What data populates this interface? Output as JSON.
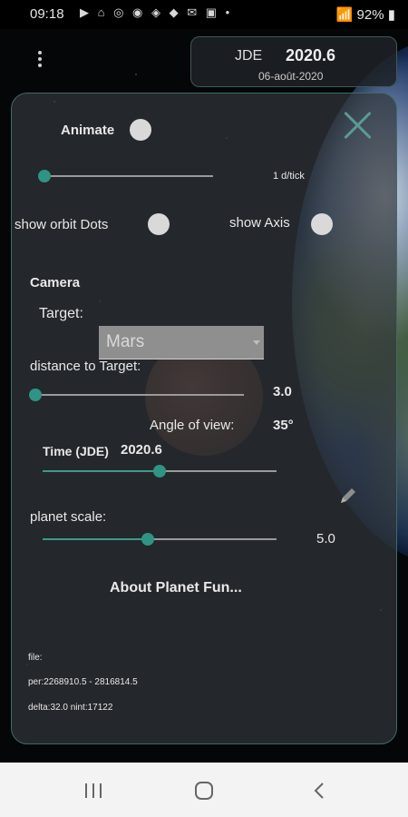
{
  "status_bar": {
    "time": "09:18",
    "battery": "92%",
    "notification_icons": [
      "youtube-icon",
      "bank-icon",
      "sync-icon",
      "chrome-icon",
      "maps-icon",
      "maps-pin-icon",
      "gmail-icon",
      "gallery-icon"
    ]
  },
  "header": {
    "jde_label": "JDE",
    "jde_value": "2020.6",
    "date": "06-août-2020"
  },
  "panel": {
    "animate_label": "Animate",
    "tick_value_label": "1 d/tick",
    "tick_slider_value": 0.0,
    "show_orbit_dots_label": "show orbit Dots",
    "show_axis_label": "show Axis",
    "camera_heading": "Camera",
    "target_label": "Target:",
    "target_value": "Mars",
    "distance_label": "distance to Target:",
    "distance_value": "3.0",
    "distance_slider_value": 0.0,
    "angle_label": "Angle of view:",
    "angle_value": "35°",
    "time_label": "Time (JDE)",
    "time_value": "2020.6",
    "time_slider_value": 0.5,
    "planet_scale_label": "planet scale:",
    "planet_scale_value": "5.0",
    "planet_scale_slider_value": 0.45,
    "about_link": "About Planet Fun...",
    "file_label": "file:",
    "per_text": "per:2268910.5 - 2816814.5",
    "delta_text": "delta:32.0 nint:17122"
  },
  "colors": {
    "accent": "#2f9483",
    "panel_border": "#3d6b66"
  }
}
